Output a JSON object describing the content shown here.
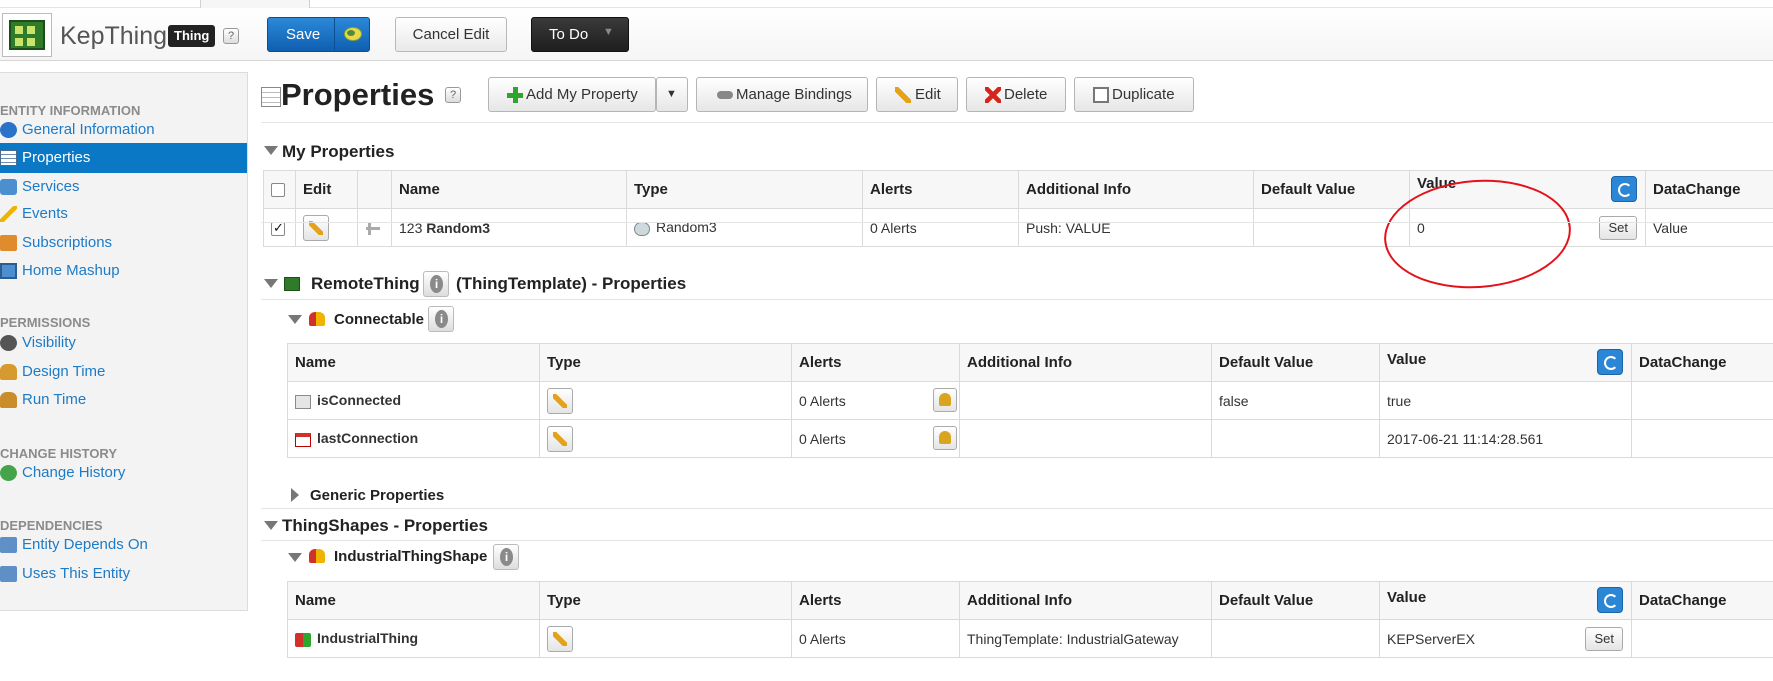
{
  "header": {
    "app_title": "KepThing",
    "entity_badge": "Thing",
    "help": "?",
    "save_label": "Save",
    "cancel_label": "Cancel Edit",
    "todo_label": "To Do"
  },
  "sidebar": {
    "sections": [
      {
        "title": "ENTITY INFORMATION",
        "items": [
          {
            "label": "General Information",
            "icon": "info-icon"
          },
          {
            "label": "Properties",
            "icon": "properties-grid-icon",
            "active": true
          },
          {
            "label": "Services",
            "icon": "services-gear-icon"
          },
          {
            "label": "Events",
            "icon": "lightning-bolt-icon"
          },
          {
            "label": "Subscriptions",
            "icon": "subscription-book-icon"
          },
          {
            "label": "Home Mashup",
            "icon": "screen-icon"
          }
        ]
      },
      {
        "title": "PERMISSIONS",
        "items": [
          {
            "label": "Visibility",
            "icon": "eye-icon"
          },
          {
            "label": "Design Time",
            "icon": "people-icon"
          },
          {
            "label": "Run Time",
            "icon": "person-run-icon"
          }
        ]
      },
      {
        "title": "CHANGE HISTORY",
        "items": [
          {
            "label": "Change History",
            "icon": "history-clock-icon"
          }
        ]
      },
      {
        "title": "DEPENDENCIES",
        "items": [
          {
            "label": "Entity Depends On",
            "icon": "dependency-icon"
          },
          {
            "label": "Uses This Entity",
            "icon": "usage-icon"
          }
        ]
      }
    ]
  },
  "main": {
    "title": "Properties",
    "help": "?",
    "toolbar": {
      "add": "Add My Property",
      "manage_bindings": "Manage Bindings",
      "edit": "Edit",
      "delete": "Delete",
      "duplicate": "Duplicate"
    },
    "my_properties": {
      "title": "My Properties",
      "columns": [
        "Edit",
        "Name",
        "Type",
        "Alerts",
        "Additional Info",
        "Default Value",
        "Value",
        "DataChange"
      ],
      "row": {
        "name_prefix": "123",
        "name": "Random3",
        "type": "Random3",
        "alerts": "0 Alerts",
        "additional_info": "Push: VALUE",
        "default_value": "",
        "value": "0",
        "set_label": "Set",
        "data_change": "Value",
        "checked": true
      }
    },
    "remote_thing": {
      "name": "RemoteThing",
      "suffix": "(ThingTemplate) - Properties",
      "connectable": {
        "title": "Connectable",
        "columns": [
          "Name",
          "Type",
          "Alerts",
          "Additional Info",
          "Default Value",
          "Value",
          "DataChange"
        ],
        "rows": [
          {
            "name": "isConnected",
            "alerts": "0 Alerts",
            "additional_info": "",
            "default_value": "false",
            "value": "true",
            "data_change": ""
          },
          {
            "name": "lastConnection",
            "alerts": "0 Alerts",
            "additional_info": "",
            "default_value": "",
            "value": "2017-06-21 11:14:28.561",
            "data_change": ""
          }
        ]
      },
      "generic": "Generic Properties"
    },
    "thing_shapes": {
      "title": "ThingShapes - Properties",
      "shape": {
        "title": "IndustrialThingShape",
        "columns": [
          "Name",
          "Type",
          "Alerts",
          "Additional Info",
          "Default Value",
          "Value",
          "DataChange"
        ],
        "rows": [
          {
            "name": "IndustrialThing",
            "alerts": "0 Alerts",
            "additional_info": "ThingTemplate: IndustrialGateway",
            "default_value": "",
            "value": "KEPServerEX",
            "set_label": "Set",
            "data_change": ""
          }
        ]
      }
    }
  },
  "colors": {
    "primary": "#0a78c5",
    "save_button": "#1a71c4",
    "annotation_red": "#e4111b"
  }
}
